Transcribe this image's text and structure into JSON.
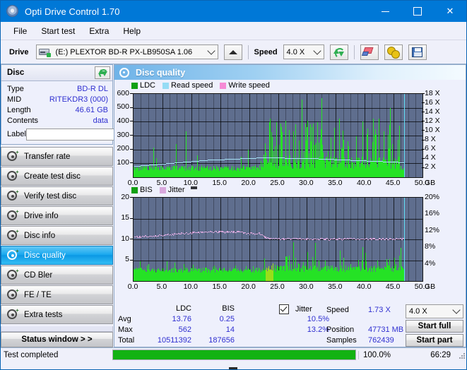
{
  "window": {
    "title": "Opti Drive Control 1.70",
    "icon": "disc-icon",
    "minimize": "−",
    "maximize": "□",
    "close": "✕"
  },
  "menu": {
    "items": [
      "File",
      "Start test",
      "Extra",
      "Help"
    ]
  },
  "toolbar": {
    "drive_label": "Drive",
    "drive_value": "(E:)   PLEXTOR BD-R  PX-LB950SA 1.06",
    "eject_icon": "eject-icon",
    "speed_label": "Speed",
    "speed_value": "4.0 X",
    "refresh_icon": "refresh-icon",
    "eraser_icon": "eraser-icon",
    "gears_icon": "gears-icon",
    "save_icon": "save-icon"
  },
  "disc_panel": {
    "title": "Disc",
    "refresh_icon": "refresh-icon",
    "rows": [
      {
        "key": "Type",
        "value": "BD-R DL"
      },
      {
        "key": "MID",
        "value": "RITEKDR3 (000)"
      },
      {
        "key": "Length",
        "value": "46.61 GB"
      },
      {
        "key": "Contents",
        "value": "data"
      }
    ],
    "label_key": "Label",
    "label_value": "",
    "label_placeholder": "",
    "disc_icon": "cd-icon"
  },
  "sidebar": {
    "items": [
      {
        "label": "Transfer rate",
        "active": false
      },
      {
        "label": "Create test disc",
        "active": false
      },
      {
        "label": "Verify test disc",
        "active": false
      },
      {
        "label": "Drive info",
        "active": false
      },
      {
        "label": "Disc info",
        "active": false
      },
      {
        "label": "Disc quality",
        "active": true
      },
      {
        "label": "CD Bler",
        "active": false
      },
      {
        "label": "FE / TE",
        "active": false
      },
      {
        "label": "Extra tests",
        "active": false
      }
    ],
    "status_window_button": "Status window > >"
  },
  "main": {
    "header_title": "Disc quality",
    "header_icon": "disc-quality-icon"
  },
  "chart_data": [
    {
      "type": "bar",
      "id": "ldc-chart",
      "title": "",
      "legend": [
        {
          "label": "LDC",
          "color": "#12a012"
        },
        {
          "label": "Read speed",
          "color": "#95dcf5"
        },
        {
          "label": "Write speed",
          "color": "#f58ad5"
        }
      ],
      "legend_position": "top-left",
      "xlabel": "GB",
      "ylabel": "",
      "xlim": [
        0,
        50
      ],
      "xticks": [
        "0.0",
        "5.0",
        "10.0",
        "15.0",
        "20.0",
        "25.0",
        "30.0",
        "35.0",
        "40.0",
        "45.0",
        "50.0"
      ],
      "ylim": [
        0,
        600
      ],
      "yticks": [
        100,
        200,
        300,
        400,
        500,
        600
      ],
      "y2label": "X",
      "y2lim": [
        0,
        18
      ],
      "y2ticks": [
        "2 X",
        "4 X",
        "6 X",
        "8 X",
        "10 X",
        "12 X",
        "14 X",
        "16 X",
        "18 X"
      ],
      "grid": true,
      "series": [
        {
          "name": "LDC",
          "color": "#25e225",
          "kind": "bars"
        },
        {
          "name": "Read speed",
          "color": "#a8e4f8",
          "kind": "line"
        }
      ],
      "data_end_gb": 46.8,
      "cursor_gb": 46.8
    },
    {
      "type": "bar",
      "id": "bis-chart",
      "title": "",
      "legend": [
        {
          "label": "BIS",
          "color": "#12a012"
        },
        {
          "label": "Jitter",
          "color": "#d9a8dd"
        }
      ],
      "legend_position": "top-left",
      "xlabel": "GB",
      "ylabel": "",
      "xlim": [
        0,
        50
      ],
      "xticks": [
        "0.0",
        "5.0",
        "10.0",
        "15.0",
        "20.0",
        "25.0",
        "30.0",
        "35.0",
        "40.0",
        "45.0",
        "50.0"
      ],
      "ylim": [
        0,
        20
      ],
      "yticks": [
        5,
        10,
        15,
        20
      ],
      "y2label": "%",
      "y2lim": [
        0,
        20
      ],
      "y2ticks": [
        "4%",
        "8%",
        "12%",
        "16%",
        "20%"
      ],
      "grid": true,
      "series": [
        {
          "name": "BIS",
          "color": "#25e225",
          "kind": "bars"
        },
        {
          "name": "Jitter",
          "color": "#d9a8dd",
          "kind": "line"
        }
      ],
      "data_end_gb": 46.8,
      "cursor_gb": 46.8
    }
  ],
  "stats": {
    "col_headers": [
      "LDC",
      "BIS"
    ],
    "row_headers": [
      "Avg",
      "Max",
      "Total"
    ],
    "ldc": {
      "avg": "13.76",
      "max": "562",
      "total": "10511392"
    },
    "bis": {
      "avg": "0.25",
      "max": "14",
      "total": "187656"
    },
    "jitter": {
      "label": "Jitter",
      "checked": true,
      "avg": "10.5%",
      "max": "13.2%"
    },
    "speed_label": "Speed",
    "speed_value": "1.73 X",
    "position_label": "Position",
    "position_value": "47731 MB",
    "samples_label": "Samples",
    "samples_value": "762439",
    "speed_select": "4.0 X",
    "start_full_button": "Start full",
    "start_part_button": "Start part"
  },
  "statusbar": {
    "text": "Test completed",
    "progress_percent": 100,
    "progress_label": "100.0%",
    "time": "66:29"
  },
  "colors": {
    "accent": "#0078d7",
    "plot_bg": "#5f6e8e",
    "ldc_green": "#25e225",
    "read_speed": "#a8e4f8",
    "jitter_pink": "#d9a8dd",
    "link_blue": "#2f2fd0",
    "progress_green": "#12b212"
  }
}
